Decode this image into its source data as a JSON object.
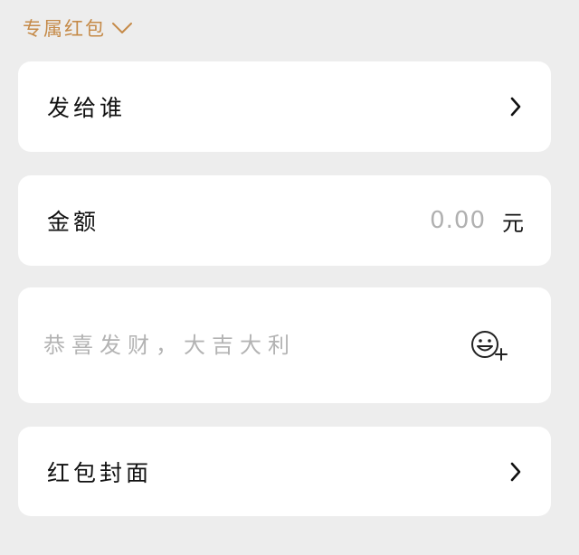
{
  "header": {
    "type_label": "专属红包",
    "dropdown_icon": "chevron-down-icon",
    "accent_color": "#c58a48"
  },
  "recipient": {
    "label": "发给谁",
    "icon": "chevron-right-icon"
  },
  "amount": {
    "label": "金额",
    "placeholder": "0.00",
    "value": "",
    "currency": "元"
  },
  "greeting": {
    "placeholder": "恭喜发财，大吉大利",
    "value": "",
    "emoji_icon": "emoji-add-icon"
  },
  "cover": {
    "label": "红包封面",
    "icon": "chevron-right-icon"
  }
}
